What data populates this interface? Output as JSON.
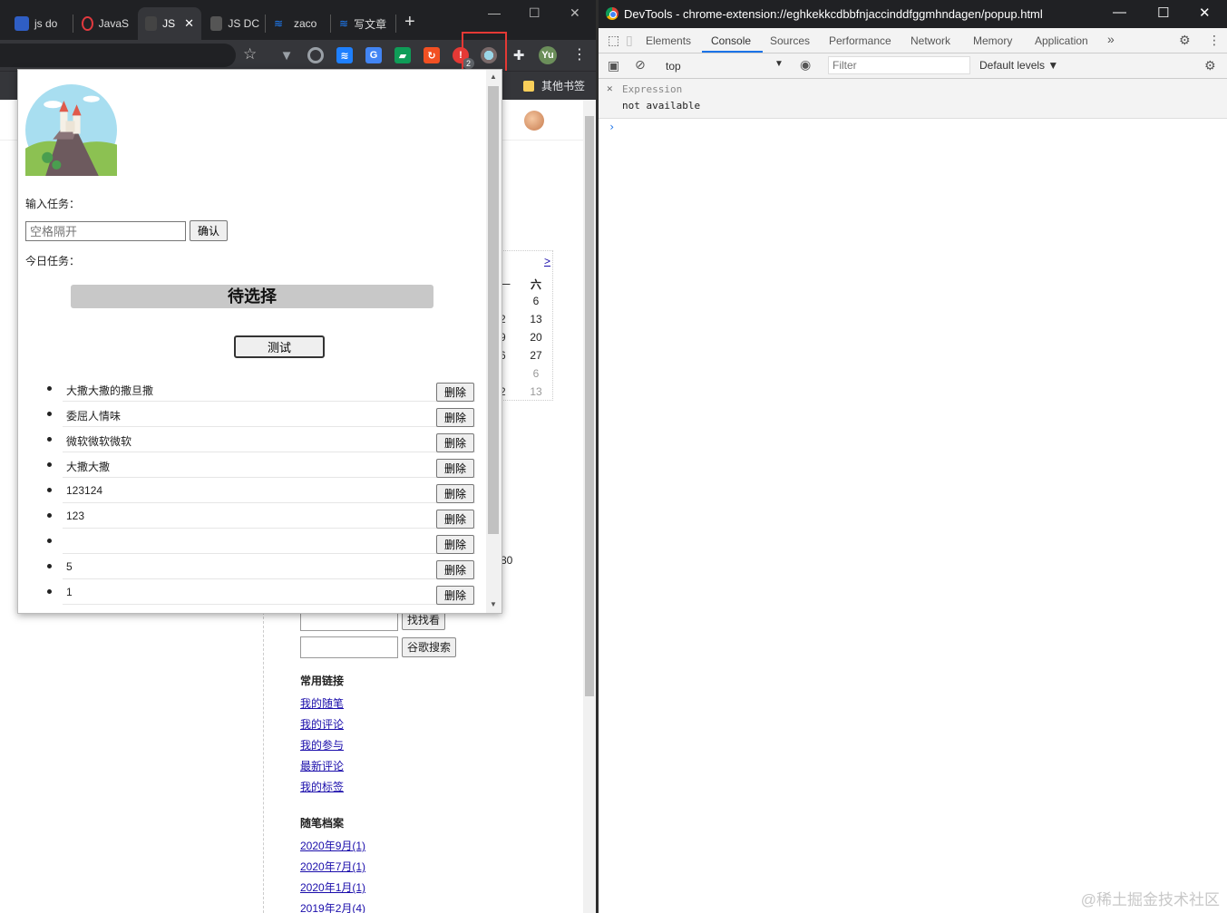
{
  "browser": {
    "tabs": [
      {
        "label": "js do",
        "active": false,
        "icon": "baidu-paw-icon"
      },
      {
        "label": "JavaS",
        "active": false,
        "icon": "red-circle-icon"
      },
      {
        "label": "JS",
        "active": true,
        "icon": "dark-site-icon"
      },
      {
        "label": "JS DC",
        "active": false,
        "icon": "dark-site-icon"
      },
      {
        "label": "zaco",
        "active": false,
        "icon": "juejin-icon"
      },
      {
        "label": "写文章",
        "active": false,
        "icon": "juejin-icon"
      }
    ],
    "new_tab": "+",
    "profile_initials": "Yu",
    "extension_badge": "2",
    "bookmarks_other": "其他书签"
  },
  "page": {
    "calendar": {
      "next": ">",
      "header": "六",
      "days": [
        "6",
        "13",
        "20",
        "27",
        "6",
        "13"
      ],
      "left_cut": [
        "一",
        "2",
        "9",
        "6",
        "",
        "2"
      ]
    },
    "side_partial": "80",
    "find_button": "找找看",
    "google_button": "谷歌搜索",
    "common_links_title": "常用链接",
    "common_links": [
      "我的随笔",
      "我的评论",
      "我的参与",
      "最新评论",
      "我的标签"
    ],
    "archive_title": "随笔档案",
    "archive_links": [
      "2020年9月(1)",
      "2020年7月(1)",
      "2020年1月(1)",
      "2019年2月(4)"
    ]
  },
  "popup": {
    "input_label": "输入任务：",
    "input_placeholder": "空格隔开",
    "confirm_label": "确认",
    "today_label": "今日任务：",
    "pending_label": "待选择",
    "test_label": "测试",
    "delete_label": "删除",
    "tasks": [
      "大撒大撒的撒旦撒",
      "委屈人情味",
      "微软微软微软",
      "大撒大撒",
      "123124",
      "123",
      "",
      "5",
      "1"
    ]
  },
  "devtools": {
    "title": "DevTools - chrome-extension://eghkekkcdbbfnjaccinddfggmhndagen/popup.html",
    "tabs": [
      "Elements",
      "Console",
      "Sources",
      "Performance",
      "Network",
      "Memory",
      "Application"
    ],
    "active_tab": "Console",
    "more": "»",
    "context": "top",
    "filter_placeholder": "Filter",
    "levels": "Default levels ▼",
    "expression_label": "Expression",
    "expression_value": "not available",
    "prompt": "›"
  },
  "watermark": "@稀土掘金技术社区",
  "colors": {
    "accent": "#1a73e8",
    "highlight": "#e53935",
    "tabstrip": "#202124",
    "toolbar": "#35363a"
  }
}
